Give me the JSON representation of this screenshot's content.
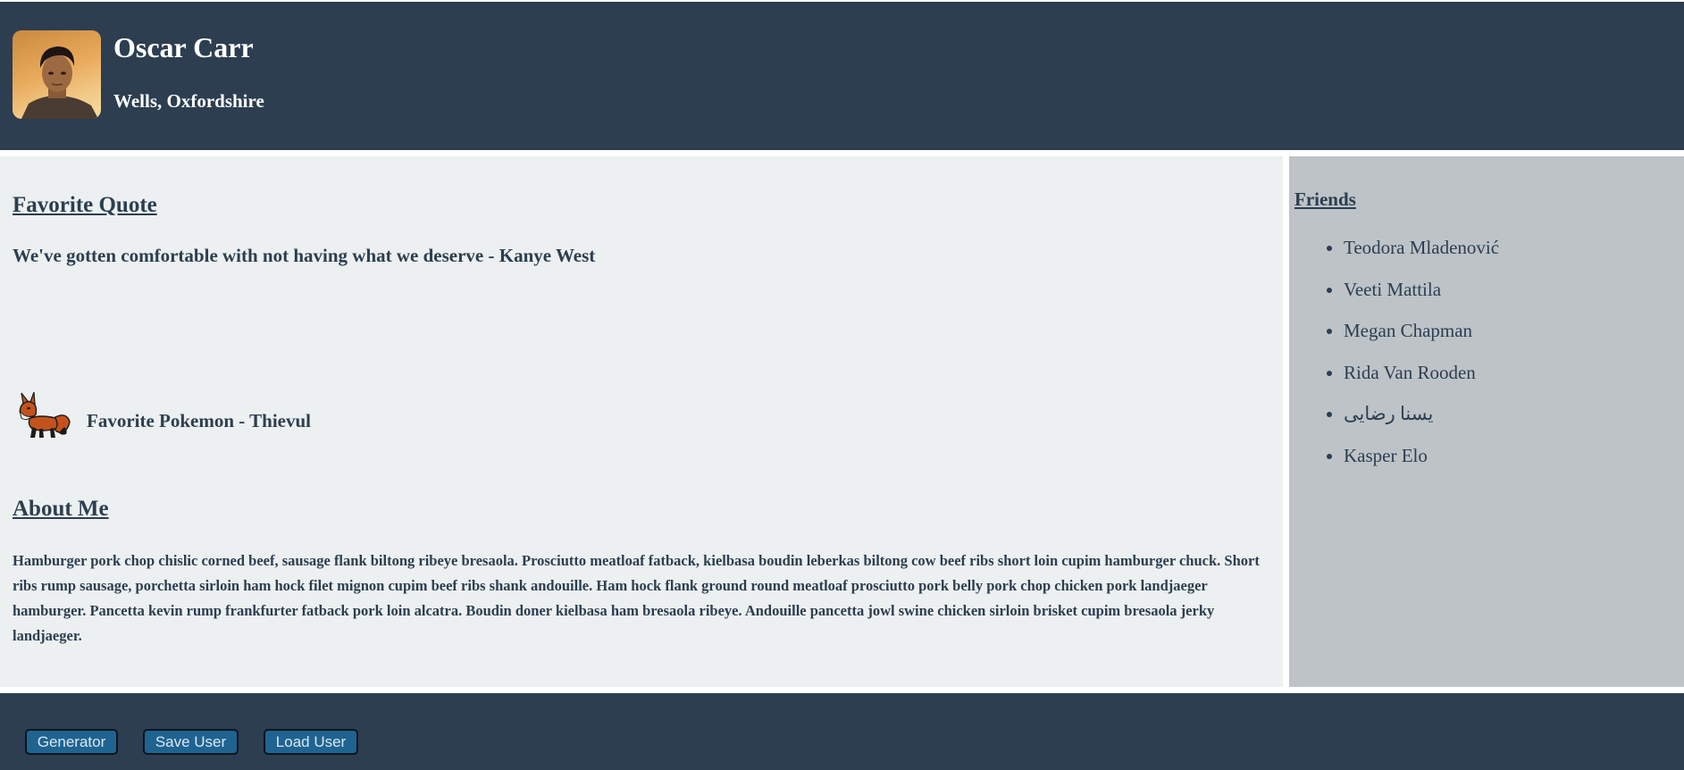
{
  "header": {
    "name": "Oscar Carr",
    "location": "Wells, Oxfordshire",
    "avatar_icon": "user-photo-avatar"
  },
  "quote": {
    "heading": "Favorite Quote",
    "text": "We've gotten comfortable with not having what we deserve - Kanye West"
  },
  "pokemon": {
    "label": "Favorite Pokemon - Thievul",
    "icon": "fox-pokemon-sprite"
  },
  "about": {
    "heading": "About Me",
    "text": "Hamburger pork chop chislic corned beef, sausage flank biltong ribeye bresaola. Prosciutto meatloaf fatback, kielbasa boudin leberkas biltong cow beef ribs short loin cupim hamburger chuck. Short ribs rump sausage, porchetta sirloin ham hock filet mignon cupim beef ribs shank andouille. Ham hock flank ground round meatloaf prosciutto pork belly pork chop chicken pork landjaeger hamburger. Pancetta kevin rump frankfurter fatback pork loin alcatra. Boudin doner kielbasa ham bresaola ribeye. Andouille pancetta jowl swine chicken sirloin brisket cupim bresaola jerky landjaeger."
  },
  "friends": {
    "heading": "Friends",
    "items": [
      "Teodora Mladenović",
      "Veeti Mattila",
      "Megan Chapman",
      "Rida Van Rooden",
      "یسنا رضایی",
      "Kasper Elo"
    ]
  },
  "footer": {
    "generator_label": "Generator",
    "save_label": "Save User",
    "load_label": "Load User"
  },
  "colors": {
    "header_bg": "#2c3e50",
    "main_bg": "#ecf0f1",
    "sidebar_bg": "#bdc3c7",
    "button_bg": "#1f6391"
  }
}
